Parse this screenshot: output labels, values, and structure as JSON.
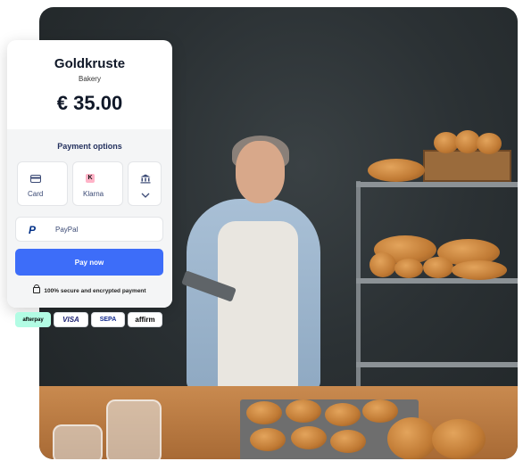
{
  "merchant": {
    "name": "Goldkruste",
    "category": "Bakery",
    "amount": "€ 35.00"
  },
  "payment": {
    "title": "Payment options",
    "options": [
      {
        "label": "Card",
        "icon": "card-icon"
      },
      {
        "label": "Klarna",
        "icon": "klarna-icon"
      },
      {
        "label": "",
        "icon": "bank-icon"
      }
    ],
    "paypal": {
      "label": "PayPal",
      "icon": "paypal-icon"
    },
    "pay_button": "Pay now",
    "secure_note": "100% secure and encrypted payment"
  },
  "badges": [
    "afterpay",
    "VISA",
    "SEPA",
    "affirm"
  ],
  "colors": {
    "accent": "#3d6df9",
    "options_title": "#24315e",
    "afterpay": "#b2fce4",
    "klarna": "#ffb3c7"
  }
}
